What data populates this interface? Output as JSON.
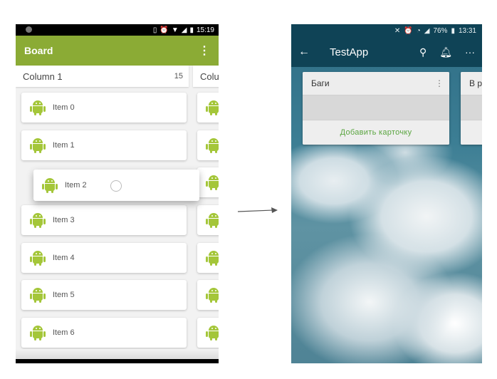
{
  "left": {
    "status": {
      "time": "15:19"
    },
    "appbar": {
      "title": "Board",
      "menu_icon": "more-vert-icon"
    },
    "columns": [
      {
        "title": "Column 1",
        "count": "15"
      },
      {
        "title": "Colu",
        "count": ""
      }
    ],
    "items": [
      "Item 0",
      "Item 1",
      "Item 2",
      "Item 3",
      "Item 4",
      "Item 5",
      "Item 6"
    ],
    "colors": {
      "appbar": "#8bab35",
      "android_green": "#a4c639"
    }
  },
  "right": {
    "status": {
      "battery": "76%",
      "time": "13:31"
    },
    "appbar": {
      "title": "TestApp"
    },
    "lists": [
      {
        "title": "Баги",
        "add_label": "Добавить карточку"
      },
      {
        "title": "В р"
      }
    ],
    "colors": {
      "appbar": "#0f4356",
      "add_label": "#5aa540"
    }
  }
}
